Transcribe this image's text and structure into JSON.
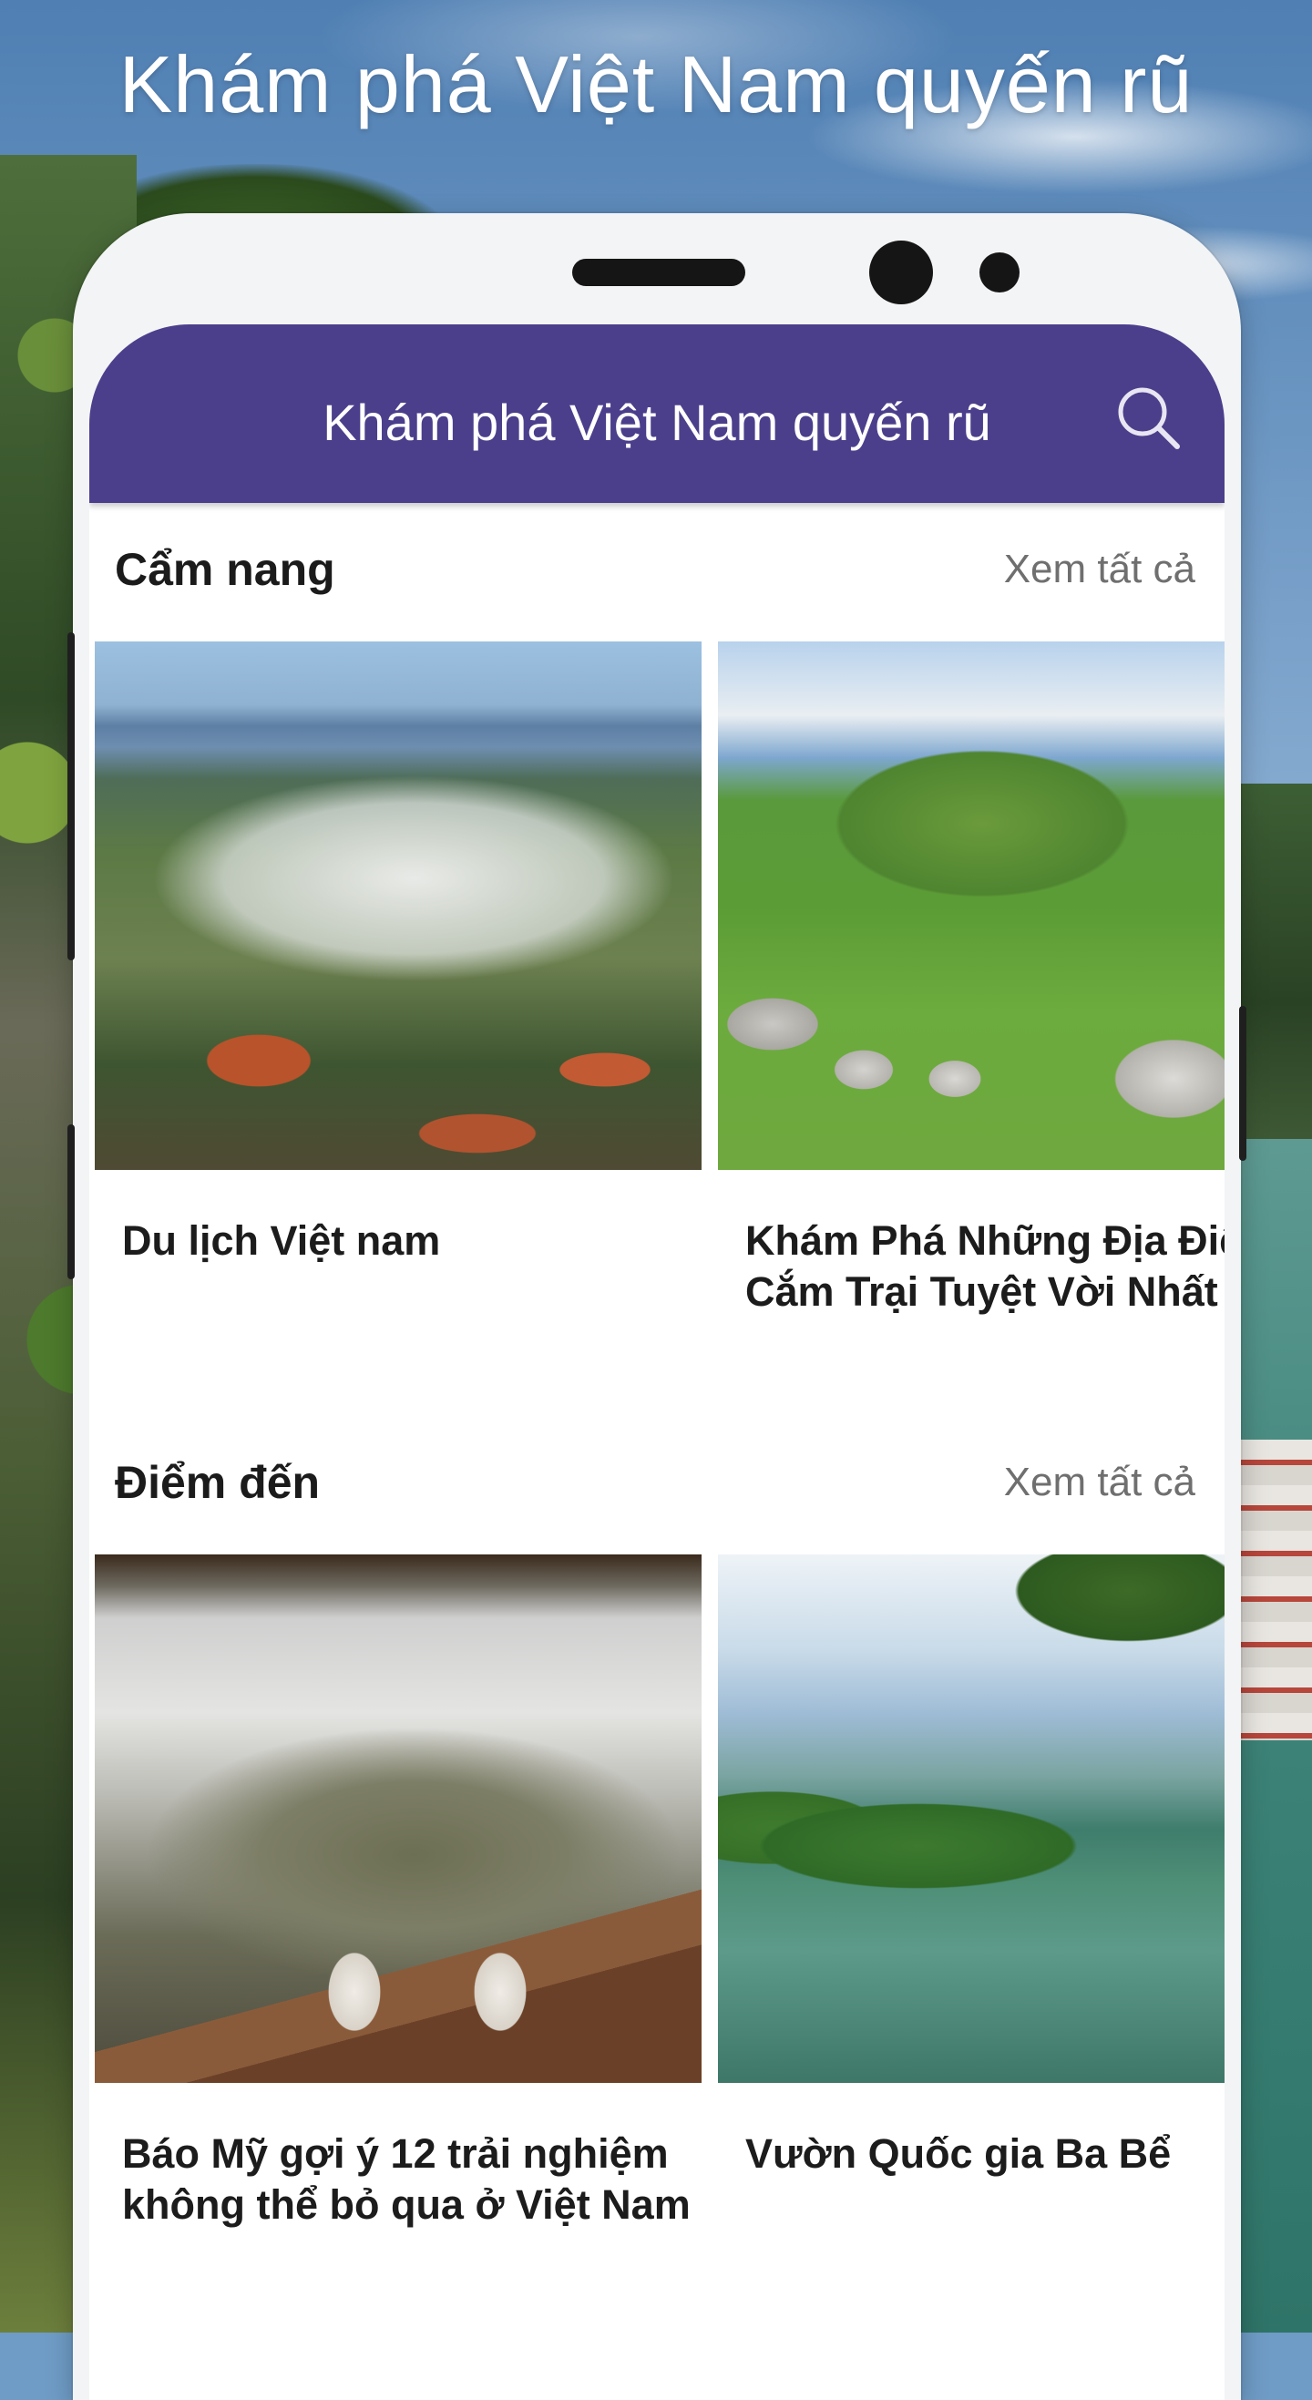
{
  "promo": {
    "headline": "Khám phá Việt Nam quyến rũ"
  },
  "app": {
    "title": "Khám phá Việt Nam quyến rũ",
    "search_icon": "search-icon",
    "primary_color": "#4b3f8c"
  },
  "sections": [
    {
      "title": "Cẩm nang",
      "view_all": "Xem tất cả",
      "cards": [
        {
          "title_line1": "Du lịch Việt nam",
          "title_line2": ""
        },
        {
          "title_line1": "Khám Phá Những Địa Điểm",
          "title_line2": "Cắm Trại Tuyệt Vời Nhất Vi"
        }
      ]
    },
    {
      "title": "Điểm đến",
      "view_all": "Xem tất cả",
      "cards": [
        {
          "title_line1": "Báo Mỹ gợi ý 12 trải nghiệm",
          "title_line2": "không thể bỏ qua ở Việt Nam"
        },
        {
          "title_line1": "Vườn Quốc gia Ba Bể",
          "title_line2": ""
        }
      ]
    }
  ]
}
